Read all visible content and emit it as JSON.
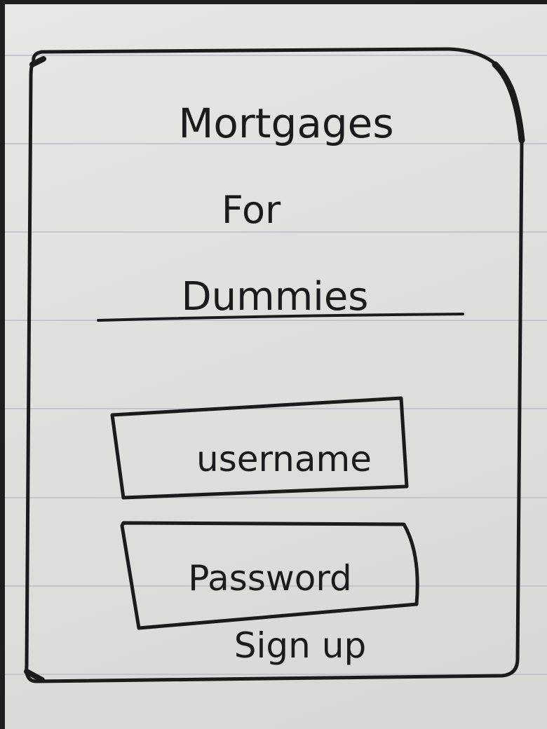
{
  "app": {
    "title_line1": "Mortgages",
    "title_line2": "For",
    "title_line3": "Dummies"
  },
  "login": {
    "username_placeholder": "username",
    "password_placeholder": "Password",
    "signup_label": "Sign up"
  },
  "colors": {
    "ink": "#1b1b1b",
    "paper": "#e3e3e1",
    "rule_line": "#b9bccb"
  }
}
